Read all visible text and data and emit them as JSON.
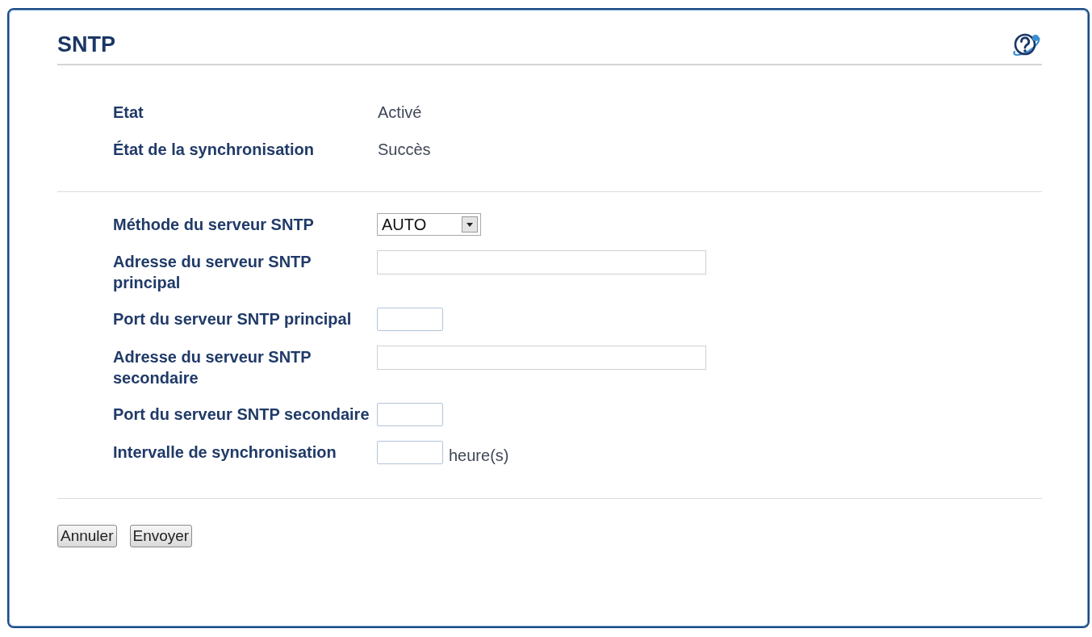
{
  "page": {
    "title": "SNTP"
  },
  "status": [
    {
      "label": "Etat",
      "value": "Activé"
    },
    {
      "label": "État de la synchronisation",
      "value": "Succès"
    }
  ],
  "settings": [
    {
      "kind": "select",
      "label": "Méthode du serveur SNTP",
      "value": "AUTO"
    },
    {
      "kind": "wide",
      "label": "Adresse du serveur SNTP principal"
    },
    {
      "kind": "short",
      "label": "Port du serveur SNTP principal"
    },
    {
      "kind": "wide",
      "label": "Adresse du serveur SNTP secondaire"
    },
    {
      "kind": "short",
      "label": "Port du serveur SNTP secondaire"
    },
    {
      "kind": "short",
      "label": "Intervalle de synchronisation",
      "unit": "heure(s)"
    }
  ],
  "buttons": [
    {
      "label": "Annuler"
    },
    {
      "label": "Envoyer"
    }
  ]
}
